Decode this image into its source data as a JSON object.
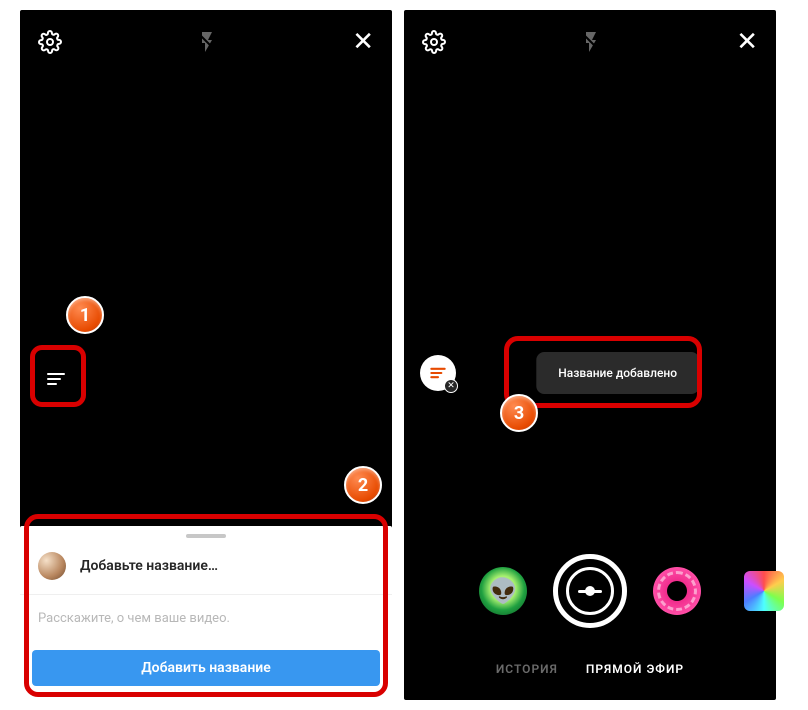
{
  "left": {
    "sheet": {
      "title": "Добавьте название…",
      "desc": "Расскажите, о чем ваше видео.",
      "button": "Добавить название"
    }
  },
  "right": {
    "toast": "Название добавлено",
    "modes": {
      "story": "ИСТОРИЯ",
      "live": "ПРЯМОЙ ЭФИР"
    }
  },
  "badges": {
    "one": "1",
    "two": "2",
    "three": "3"
  }
}
